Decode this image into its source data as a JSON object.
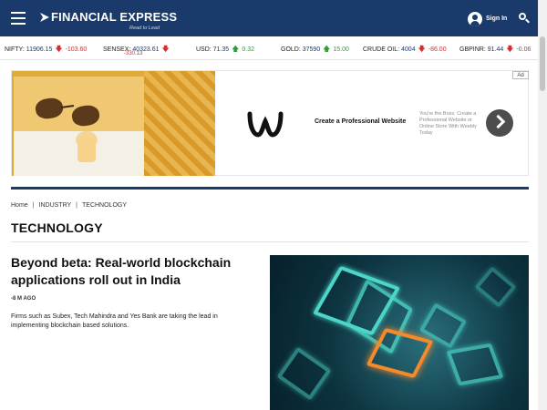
{
  "header": {
    "logo_text": "FINANCIAL EXPRESS",
    "logo_tagline": "Read to Lead",
    "signin_label": "Sign In",
    "brand_color": "#1a3a6b"
  },
  "ticker": [
    {
      "name": "NIFTY:",
      "value": "11906.15",
      "direction": "down",
      "change": "-103.60"
    },
    {
      "name": "SENSEX:",
      "value": "40323.61",
      "direction": "down",
      "change": "-330.13"
    },
    {
      "name": "USD:",
      "value": "71.35",
      "direction": "up",
      "change": "0.32"
    },
    {
      "name": "GOLD:",
      "value": "37590",
      "direction": "up",
      "change": "15.00"
    },
    {
      "name": "CRUDE OIL:",
      "value": "4004",
      "direction": "down",
      "change": "-86.00"
    },
    {
      "name": "GBPINR:",
      "value": "91.44",
      "direction": "down",
      "change": "-0.06"
    }
  ],
  "ad": {
    "label": "Ad",
    "headline": "Create a Professional Website",
    "description": "You're the Boss. Create a Professional Website or Online Store With Weebly Today"
  },
  "breadcrumb": [
    "Home",
    "INDUSTRY",
    "TECHNOLOGY"
  ],
  "section_title": "TECHNOLOGY",
  "article": {
    "title": "Beyond beta: Real-world blockchain applications roll out in India",
    "time": "-8 M AGO",
    "summary": "Firms such as Subex, Tech Mahindra and Yes Bank are taking the lead in implementing blockchain based solutions."
  },
  "icons": {
    "menu": "hamburger-icon",
    "user": "user-icon",
    "search": "search-icon",
    "ad_next": "chevron-right-icon"
  }
}
